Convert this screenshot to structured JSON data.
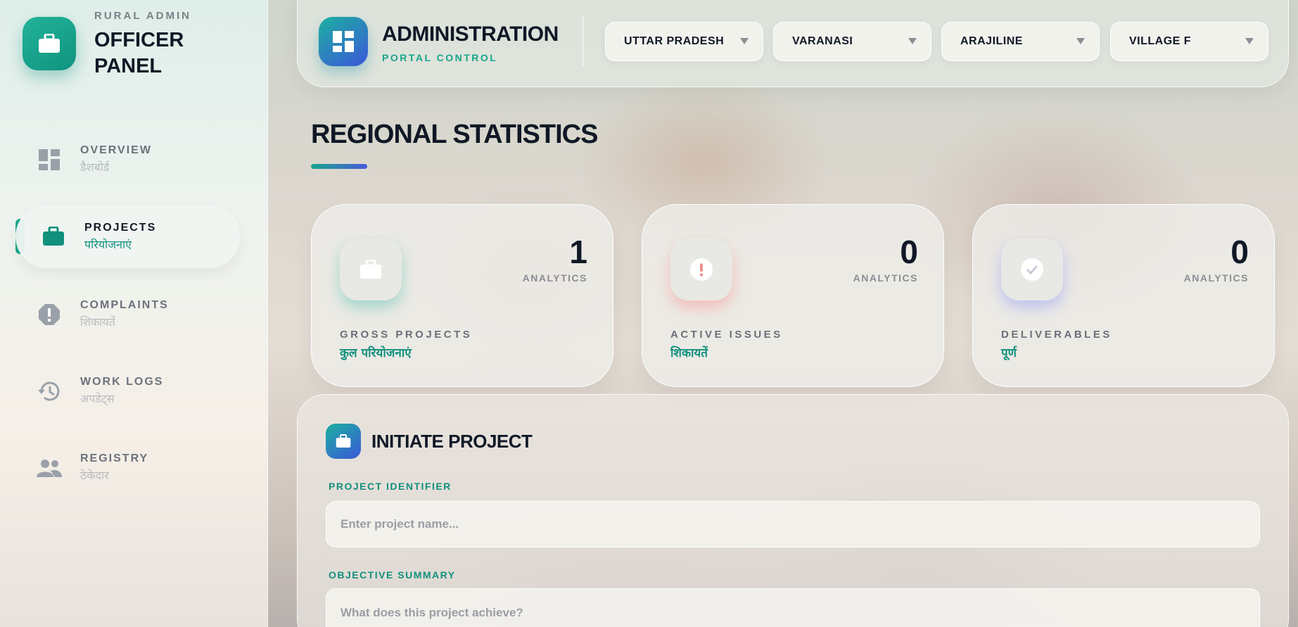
{
  "brand": {
    "subtitle": "RURAL ADMIN",
    "title": "OFFICER PANEL",
    "icon": "briefcase-icon"
  },
  "sidebar": {
    "items": [
      {
        "label": "OVERVIEW",
        "hindi": "डैशबोर्ड",
        "icon": "dashboard-icon",
        "active": false
      },
      {
        "label": "PROJECTS",
        "hindi": "परियोजनाएं",
        "icon": "briefcase-icon",
        "active": true
      },
      {
        "label": "COMPLAINTS",
        "hindi": "शिकायतें",
        "icon": "alert-icon",
        "active": false
      },
      {
        "label": "WORK LOGS",
        "hindi": "अपडेट्स",
        "icon": "history-icon",
        "active": false
      },
      {
        "label": "REGISTRY",
        "hindi": "ठेकेदार",
        "icon": "people-icon",
        "active": false
      }
    ]
  },
  "header": {
    "title": "ADMINISTRATION",
    "subtitle": "PORTAL CONTROL",
    "filters": [
      {
        "value": "UTTAR PRADESH"
      },
      {
        "value": "VARANASI"
      },
      {
        "value": "ARAJILINE"
      },
      {
        "value": "VILLAGE F"
      }
    ]
  },
  "main": {
    "section_title": "REGIONAL STATISTICS",
    "stats": [
      {
        "value": "1",
        "caption": "ANALYTICS",
        "label": "GROSS PROJECTS",
        "hindi": "कुल परियोजनाएं",
        "icon": "briefcase-icon",
        "glow": "#18b39a"
      },
      {
        "value": "0",
        "caption": "ANALYTICS",
        "label": "ACTIVE ISSUES",
        "hindi": "शिकायतें",
        "icon": "alert-icon",
        "glow": "#ff6b6b"
      },
      {
        "value": "0",
        "caption": "ANALYTICS",
        "label": "DELIVERABLES",
        "hindi": "पूर्ण",
        "icon": "check-icon",
        "glow": "#6b7bff"
      }
    ],
    "form": {
      "title": "INITIATE PROJECT",
      "fields": [
        {
          "label": "PROJECT IDENTIFIER",
          "placeholder": "Enter project name..."
        },
        {
          "label": "OBJECTIVE SUMMARY",
          "placeholder": "What does this project achieve?"
        }
      ]
    }
  },
  "colors": {
    "accent": "#17a58c",
    "gradient_end": "#4a5bd9",
    "text": "#101826"
  }
}
